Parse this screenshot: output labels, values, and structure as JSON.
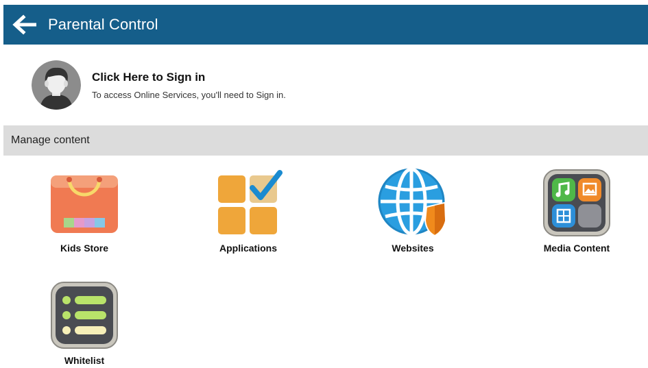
{
  "header": {
    "back_icon": "back-arrow-icon",
    "title": "Parental Control"
  },
  "signin": {
    "avatar_icon": "user-avatar-icon",
    "title": "Click Here to Sign in",
    "subtitle": "To access Online Services, you'll need to Sign in."
  },
  "section": {
    "title": "Manage content"
  },
  "items": [
    {
      "label": "Kids Store",
      "icon": "shopping-bag-icon"
    },
    {
      "label": "Applications",
      "icon": "applications-check-icon"
    },
    {
      "label": "Websites",
      "icon": "globe-shield-icon"
    },
    {
      "label": "Media Content",
      "icon": "media-grid-icon"
    },
    {
      "label": "Whitelist",
      "icon": "list-icon"
    }
  ],
  "colors": {
    "header_bg": "#155e8a",
    "section_bg": "#dcdcdc"
  }
}
